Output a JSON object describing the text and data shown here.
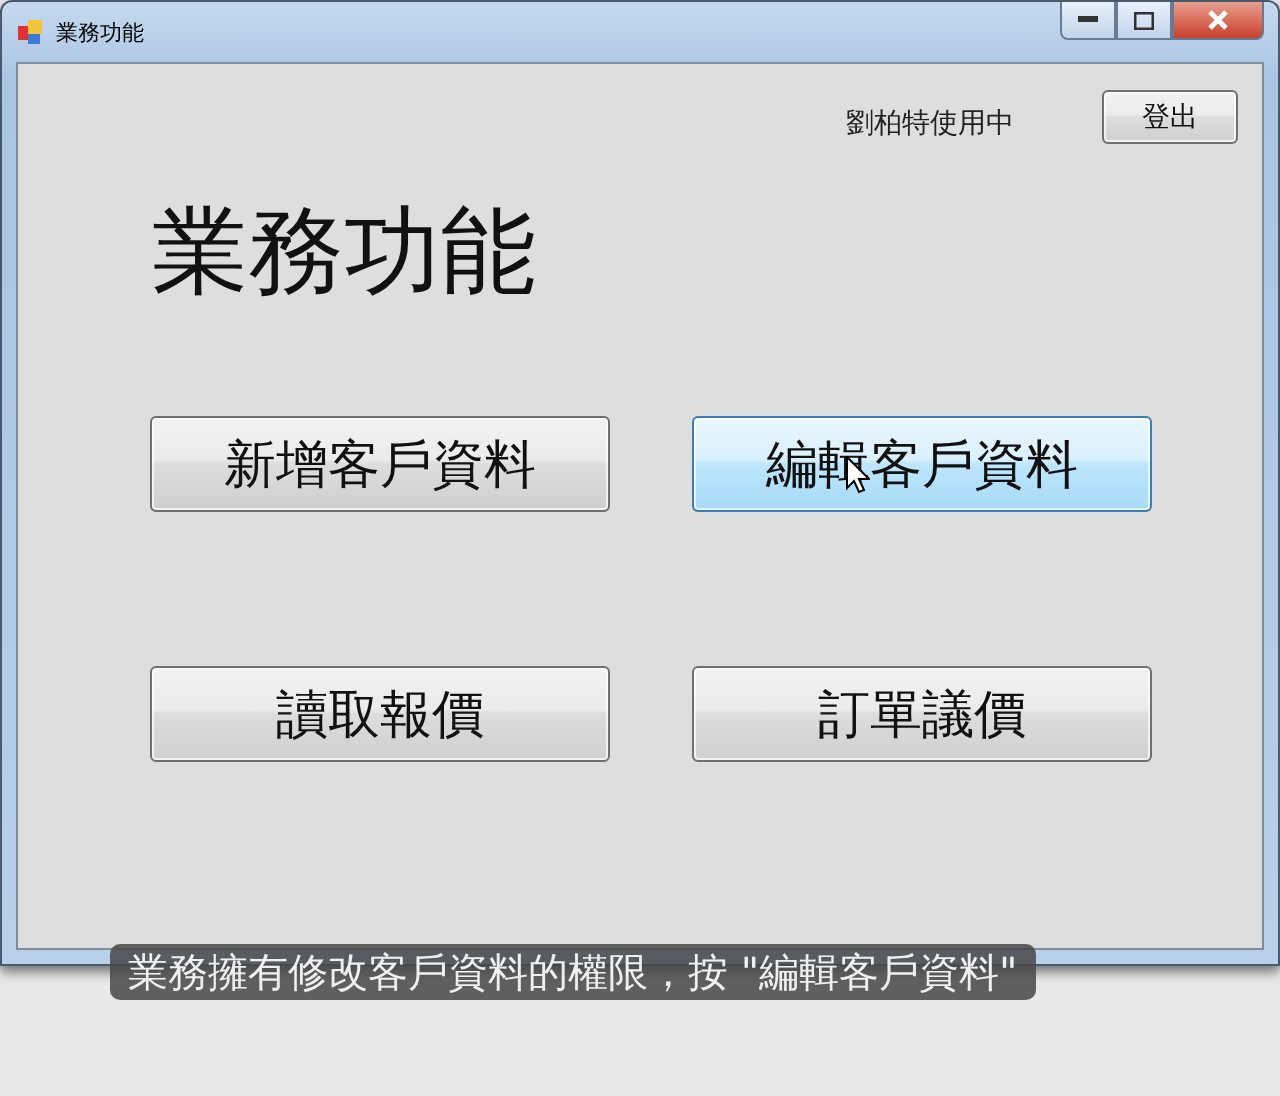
{
  "window": {
    "title": "業務功能"
  },
  "status": "劉柏特使用中",
  "logout_button": "登出",
  "heading": "業務功能",
  "buttons": [
    {
      "label": "新增客戶資料",
      "hovered": false
    },
    {
      "label": "編輯客戶資料",
      "hovered": true
    },
    {
      "label": "讀取報價",
      "hovered": false
    },
    {
      "label": "訂單議價",
      "hovered": false
    }
  ],
  "caption": "業務擁有修改客戶資料的權限，按 \"編輯客戶資料\""
}
